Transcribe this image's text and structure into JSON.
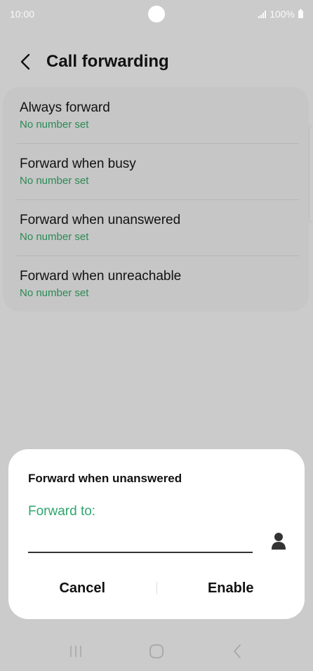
{
  "status_bar": {
    "time": "10:00",
    "battery": "100%"
  },
  "header": {
    "title": "Call forwarding",
    "back_icon": "chevron-left-icon"
  },
  "list": {
    "items": [
      {
        "title": "Always forward",
        "subtitle": "No number set"
      },
      {
        "title": "Forward when busy",
        "subtitle": "No number set"
      },
      {
        "title": "Forward when unanswered",
        "subtitle": "No number set"
      },
      {
        "title": "Forward when unreachable",
        "subtitle": "No number set"
      }
    ]
  },
  "dialog": {
    "title": "Forward when unanswered",
    "field_label": "Forward to:",
    "field_value": "",
    "contact_icon": "person-icon",
    "cancel_label": "Cancel",
    "enable_label": "Enable"
  },
  "nav": {
    "recents_icon": "recents-icon",
    "home_icon": "home-icon",
    "back_icon": "back-icon"
  },
  "colors": {
    "accent": "#2fa66d",
    "subtitle": "#2a8a55",
    "scrim": "#cbcbcb"
  }
}
